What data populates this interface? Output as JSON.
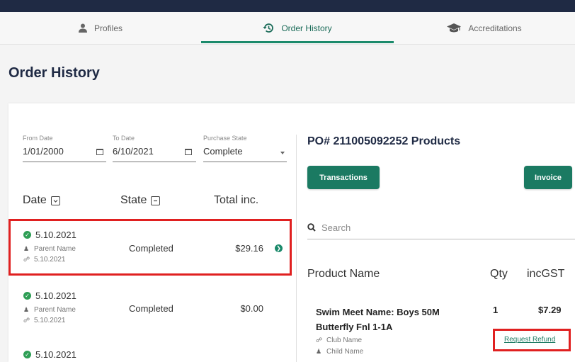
{
  "tabs": [
    {
      "label": "Profiles",
      "icon": "person-icon"
    },
    {
      "label": "Order History",
      "icon": "history-icon"
    },
    {
      "label": "Accreditations",
      "icon": "graduation-cap-icon"
    }
  ],
  "page_title": "Order History",
  "filters": {
    "from_date": {
      "label": "From Date",
      "value": "1/01/2000"
    },
    "to_date": {
      "label": "To Date",
      "value": "6/10/2021"
    },
    "purchase_state": {
      "label": "Purchase State",
      "value": "Complete"
    }
  },
  "columns": {
    "date": "Date",
    "state": "State",
    "total": "Total inc."
  },
  "orders": [
    {
      "date": "5.10.2021",
      "name": "Parent Name",
      "order_date": "5.10.2021",
      "state": "Completed",
      "total": "$29.16"
    },
    {
      "date": "5.10.2021",
      "name": "Parent Name",
      "order_date": "5.10.2021",
      "state": "Completed",
      "total": "$0.00"
    },
    {
      "date": "5.10.2021"
    }
  ],
  "detail": {
    "title": "PO# 211005092252 Products",
    "transactions_label": "Transactions",
    "invoice_label": "Invoice",
    "search_placeholder": "Search",
    "headers": {
      "product": "Product Name",
      "qty": "Qty",
      "price": "incGST"
    },
    "product": {
      "name": "Swim Meet Name: Boys 50M Butterfly Fnl 1-1A",
      "qty": "1",
      "price": "$7.29",
      "club": "Club Name",
      "child": "Child Name",
      "refund_label": "Request Refund"
    }
  },
  "colors": {
    "accent": "#1b7a62",
    "highlight": "#e02020",
    "navy": "#1f2a44"
  }
}
